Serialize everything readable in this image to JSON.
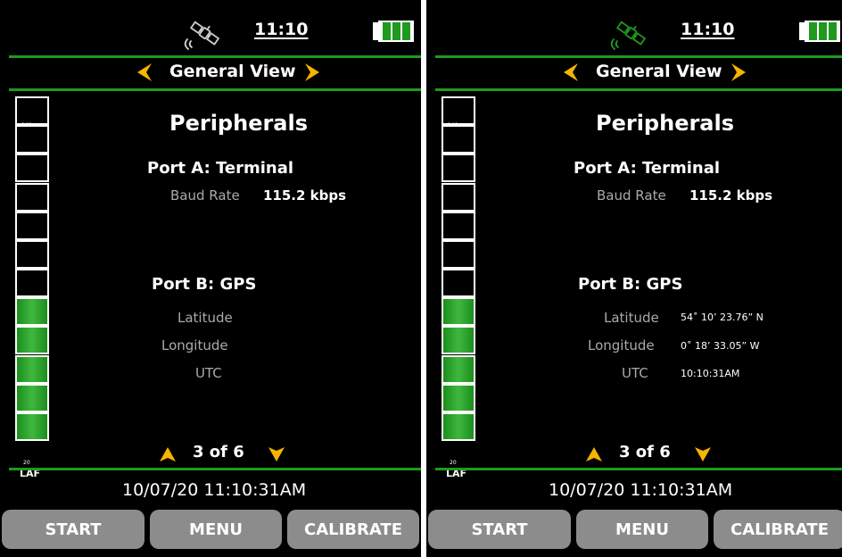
{
  "colors": {
    "accent_green": "#1f9a1f",
    "arrow_amber": "#f5b400",
    "button_gray": "#8c8c8c",
    "label_gray": "#aaaaaa"
  },
  "screens": [
    {
      "status": {
        "time": "11:10",
        "satellite_icon": "satellite-icon",
        "gps_fix": false,
        "battery_bars": 3
      },
      "view": {
        "title": "General View"
      },
      "meter": {
        "top_label": "140",
        "bottom_label": "20",
        "unit": "LAF",
        "lit_cells": 5,
        "total_cells": 12
      },
      "section_title": "Peripherals",
      "port_a": {
        "title": "Port A: Terminal",
        "baud_label": "Baud Rate",
        "baud_value": "115.2 kbps"
      },
      "port_b": {
        "title": "Port B: GPS",
        "latitude_label": "Latitude",
        "latitude_value": "",
        "longitude_label": "Longitude",
        "longitude_value": "",
        "utc_label": "UTC",
        "utc_value": ""
      },
      "pager": {
        "text": "3 of 6"
      },
      "datetime": "10/07/20 11:10:31AM",
      "buttons": {
        "start": "START",
        "menu": "MENU",
        "calibrate": "CALIBRATE"
      }
    },
    {
      "status": {
        "time": "11:10",
        "satellite_icon": "satellite-icon",
        "gps_fix": true,
        "battery_bars": 3
      },
      "view": {
        "title": "General View"
      },
      "meter": {
        "top_label": "140",
        "bottom_label": "20",
        "unit": "LAF",
        "lit_cells": 5,
        "total_cells": 12
      },
      "section_title": "Peripherals",
      "port_a": {
        "title": "Port A: Terminal",
        "baud_label": "Baud Rate",
        "baud_value": "115.2 kbps"
      },
      "port_b": {
        "title": "Port B: GPS",
        "latitude_label": "Latitude",
        "latitude_value": "54˚ 10’ 23.76” N",
        "longitude_label": "Longitude",
        "longitude_value": "0˚ 18’ 33.05” W",
        "utc_label": "UTC",
        "utc_value": "10:10:31AM"
      },
      "pager": {
        "text": "3 of 6"
      },
      "datetime": "10/07/20 11:10:31AM",
      "buttons": {
        "start": "START",
        "menu": "MENU",
        "calibrate": "CALIBRATE"
      }
    }
  ]
}
